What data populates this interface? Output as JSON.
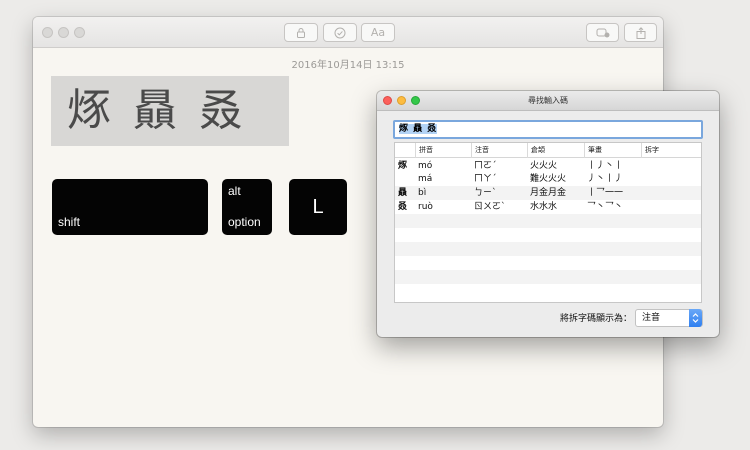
{
  "notes": {
    "date": "2016年10月14日 13:15",
    "title_chars": "烼 贔 叒",
    "toolbar": {
      "format_label": "Aa"
    },
    "keys": {
      "shift": "shift",
      "alt": "alt",
      "option": "option",
      "l": "L"
    }
  },
  "lookup": {
    "title": "尋找輸入碼",
    "search_value": "烼 贔 叒",
    "columns": [
      "",
      "拼音",
      "注音",
      "倉頡",
      "筆畫",
      "拆字"
    ],
    "rows": [
      {
        "char": "烼",
        "pinyin": "mó",
        "zhuyin": "ㄇㄛˊ",
        "cangjie": "火火火",
        "strokes": "丨丿丶丨"
      },
      {
        "char": "",
        "pinyin": "má",
        "zhuyin": "ㄇㄚˊ",
        "cangjie": "難火火火",
        "strokes": "丿丶丨丿"
      },
      {
        "char": "贔",
        "pinyin": "bì",
        "zhuyin": "ㄅㄧˋ",
        "cangjie": "月金月金",
        "strokes": "丨乛一一"
      },
      {
        "char": "叒",
        "pinyin": "ruò",
        "zhuyin": "ㄖㄨㄛˋ",
        "cangjie": "水水水",
        "strokes": "乛丶乛丶"
      }
    ],
    "footer_label": "將拆字碼顯示為：",
    "display_option": "注音"
  },
  "colors": {
    "accent": "#2f7ff0",
    "close": "#fc605c",
    "minimize": "#fdbc40",
    "zoom": "#34c84a"
  }
}
